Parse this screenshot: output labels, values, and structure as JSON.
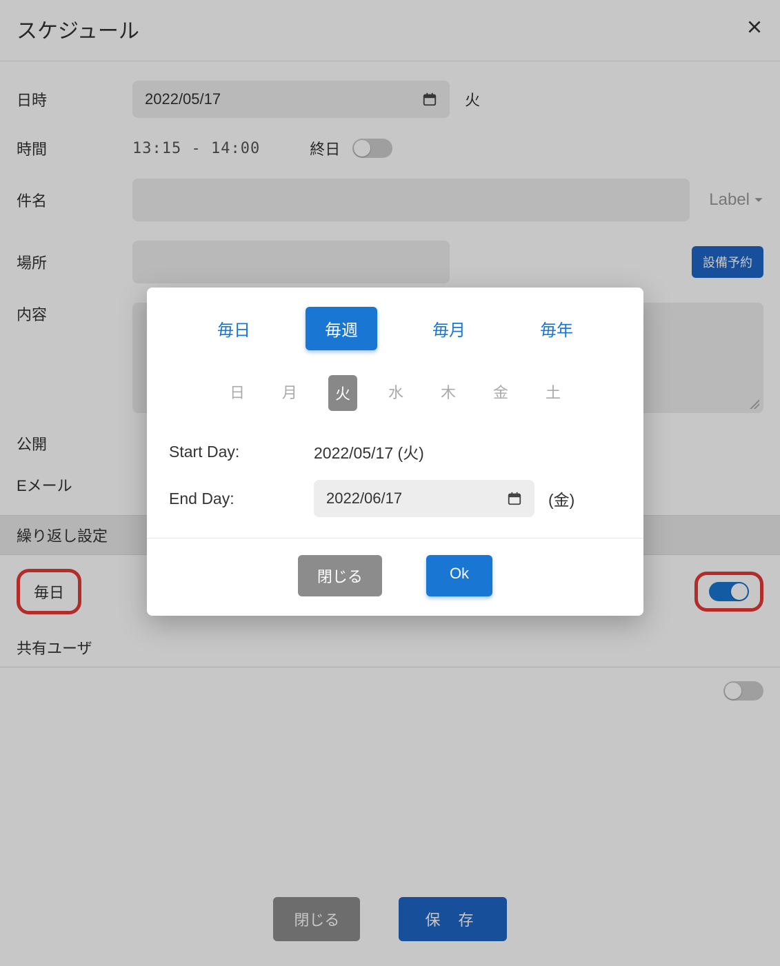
{
  "header": {
    "title": "スケジュール"
  },
  "form": {
    "date_label": "日時",
    "date_value": "2022/05/17",
    "date_day": "火",
    "time_label": "時間",
    "time_value": "13:15 - 14:00",
    "allday_label": "終日",
    "subject_label": "件名",
    "label_dropdown": "Label",
    "place_label": "場所",
    "facility_button": "設備予約",
    "content_label": "内容",
    "visibility_label": "公開",
    "email_label": "Eメール",
    "repeat_section": "繰り返し設定",
    "repeat_mode": "毎日",
    "share_section": "共有ユーザ"
  },
  "footer": {
    "close": "閉じる",
    "save": "保 存"
  },
  "dialog": {
    "tabs": {
      "daily": "毎日",
      "weekly": "毎週",
      "monthly": "毎月",
      "yearly": "毎年"
    },
    "weekdays": {
      "sun": "日",
      "mon": "月",
      "tue": "火",
      "wed": "水",
      "thu": "木",
      "fri": "金",
      "sat": "土"
    },
    "start_label": "Start Day:",
    "start_value": "2022/05/17 (火)",
    "end_label": "End Day:",
    "end_value": "2022/06/17",
    "end_day_suffix": "(金)",
    "close": "閉じる",
    "ok": "Ok"
  }
}
